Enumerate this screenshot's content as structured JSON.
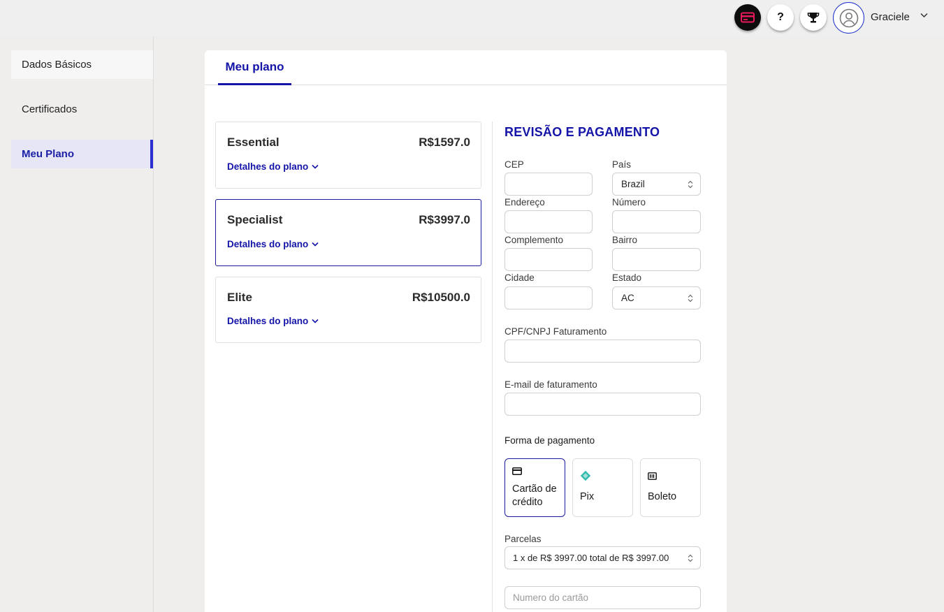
{
  "header": {
    "user_name": "Graciele",
    "icons": [
      "card-icon",
      "help-icon",
      "trophy-icon",
      "user-avatar-icon",
      "chevron-down-icon"
    ],
    "help_glyph": "?",
    "accent_card_icon_color": "#e8195a"
  },
  "sidebar": {
    "items": [
      {
        "label": "Dados Básicos"
      },
      {
        "label": "Certificados"
      },
      {
        "label": "Meu Plano",
        "active": true
      }
    ]
  },
  "main": {
    "tab_label": "Meu plano",
    "plans": [
      {
        "name": "Essential",
        "price": "R$1597.0",
        "details_label": "Detalhes do plano"
      },
      {
        "name": "Specialist",
        "price": "R$3997.0",
        "details_label": "Detalhes do plano",
        "selected": true
      },
      {
        "name": "Elite",
        "price": "R$10500.0",
        "details_label": "Detalhes do plano"
      }
    ],
    "payment": {
      "title": "REVISÃO E PAGAMENTO",
      "cep_label": "CEP",
      "cep_value": "",
      "pais_label": "País",
      "pais_value": "Brazil",
      "endereco_label": "Endereço",
      "endereco_value": "",
      "numero_label": "Número",
      "numero_value": "",
      "complemento_label": "Complemento",
      "complemento_value": "",
      "bairro_label": "Bairro",
      "bairro_value": "",
      "cidade_label": "Cidade",
      "cidade_value": "",
      "estado_label": "Estado",
      "estado_value": "AC",
      "cpf_label": "CPF/CNPJ Faturamento",
      "cpf_value": "",
      "email_label": "E-mail de faturamento",
      "email_value": "",
      "forma_label": "Forma de pagamento",
      "methods": [
        {
          "label_line1": "Cartão de",
          "label_line2": "crédito",
          "icon": "credit-card-icon",
          "selected": true
        },
        {
          "label": "Pix",
          "icon": "pix-icon"
        },
        {
          "label": "Boleto",
          "icon": "boleto-icon"
        }
      ],
      "parcelas_label": "Parcelas",
      "parcelas_value": "1 x de R$ 3997.00 total de R$ 3997.00",
      "card_number_placeholder": "Numero do cartão"
    }
  },
  "colors": {
    "brand_blue": "#1414a8",
    "sidebar_active_bg": "#e6e6f7",
    "pix_teal": "#32bcad",
    "page_bg": "#f0eeed"
  }
}
